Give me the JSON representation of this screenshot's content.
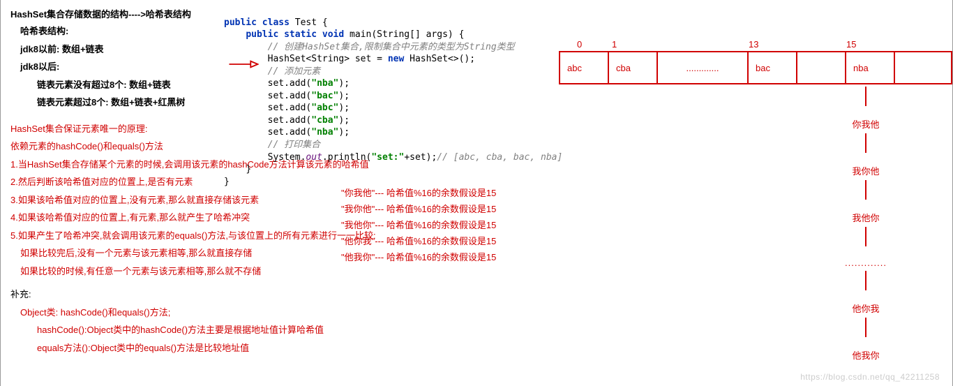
{
  "heading": "HashSet集合存储数据的结构---->哈希表结构",
  "struct_title": "哈希表结构:",
  "jdk8_before": "jdk8以前: 数组+链表",
  "jdk8_after": "jdk8以后:",
  "jdk8_after_a": "链表元素没有超过8个: 数组+链表",
  "jdk8_after_b": "链表元素超过8个: 数组+链表+红黑树",
  "principle_title": "HashSet集合保证元素唯一的原理:",
  "principle_sub": "依赖元素的hashCode()和equals()方法",
  "step1": "1.当HashSet集合存储某个元素的时候,会调用该元素的hashCode方法计算该元素的哈希值",
  "step2": "2.然后判断该哈希值对应的位置上,是否有元素",
  "step3": "3.如果该哈希值对应的位置上,没有元素,那么就直接存储该元素",
  "step4": "4.如果该哈希值对应的位置上,有元素,那么就产生了哈希冲突",
  "step5": "5.如果产生了哈希冲突,就会调用该元素的equals()方法,与该位置上的所有元素进行一一比较:",
  "step5a": "如果比较完后,没有一个元素与该元素相等,那么就直接存储",
  "step5b": "如果比较的时候,有任意一个元素与该元素相等,那么就不存储",
  "supplement": "补充:",
  "obj_line": "Object类: hashCode()和equals()方法;",
  "hashcode_line": "hashCode():Object类中的hashCode()方法主要是根据地址值计算哈希值",
  "equals_line": "equals方法():Object类中的equals()方法是比较地址值",
  "code": {
    "l1a": "public class ",
    "l1b": "Test {",
    "l2a": "public static void ",
    "l2b": "main(String[] args) {",
    "l3": "// 创建HashSet集合,限制集合中元素的类型为String类型",
    "l4a": "HashSet<String> set = ",
    "l4b": "new ",
    "l4c": "HashSet<>();",
    "l5": "// 添加元素",
    "l6a": "set.add(",
    "l6b": "\"nba\"",
    "l6c": ");",
    "l7a": "set.add(",
    "l7b": "\"bac\"",
    "l7c": ");",
    "l8a": "set.add(",
    "l8b": "\"abc\"",
    "l8c": ");",
    "l9a": "set.add(",
    "l9b": "\"cba\"",
    "l9c": ");",
    "l10a": "set.add(",
    "l10b": "\"nba\"",
    "l10c": ");",
    "l11": "// 打印集合",
    "l12a": "System.",
    "l12b": "out",
    "l12c": ".println(",
    "l12d": "\"set:\"",
    "l12e": "+set);",
    "l12f": "// [abc, cba, bac, nba]",
    "l13": "}",
    "l14": "}"
  },
  "hashlist": {
    "r1": "\"你我他\"---  哈希值%16的余数假设是15",
    "r2": "\"我你他\"---  哈希值%16的余数假设是15",
    "r3": "\"我他你\"---  哈希值%16的余数假设是15",
    "r4": "\"他你我\"---  哈希值%16的余数假设是15",
    "r5": "\"他我你\"---  哈希值%16的余数假设是15"
  },
  "buckets": {
    "idx": {
      "i0": "0",
      "i1": "1",
      "i13": "13",
      "i15": "15"
    },
    "cells": {
      "c0": "abc",
      "c1": "cba",
      "c2": ".............",
      "c3": "bac",
      "c4": "",
      "c5": "nba",
      "c6": ""
    }
  },
  "linked": {
    "n1": "你我他",
    "n2": "我你他",
    "n3": "我他你",
    "dots": ".............",
    "n4": "他你我",
    "n5": "他我你"
  },
  "watermark": "https://blog.csdn.net/qq_42211258"
}
